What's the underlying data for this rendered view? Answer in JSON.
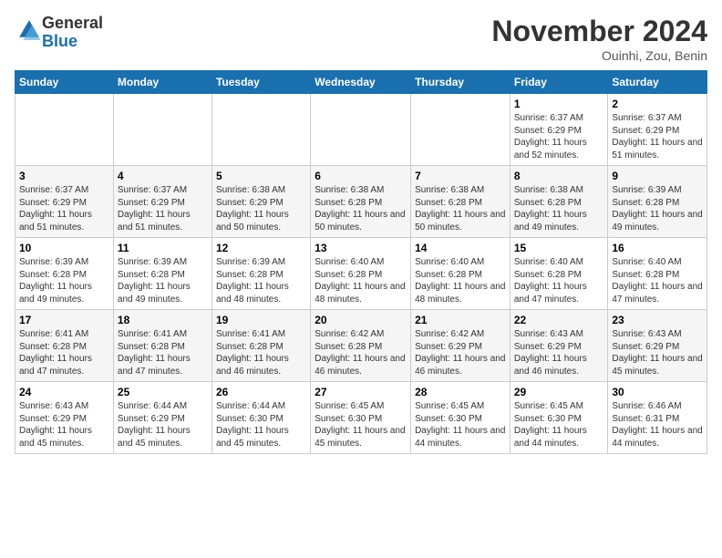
{
  "logo": {
    "general": "General",
    "blue": "Blue"
  },
  "title": "November 2024",
  "location": "Ouinhi, Zou, Benin",
  "days_of_week": [
    "Sunday",
    "Monday",
    "Tuesday",
    "Wednesday",
    "Thursday",
    "Friday",
    "Saturday"
  ],
  "weeks": [
    [
      {
        "day": "",
        "info": ""
      },
      {
        "day": "",
        "info": ""
      },
      {
        "day": "",
        "info": ""
      },
      {
        "day": "",
        "info": ""
      },
      {
        "day": "",
        "info": ""
      },
      {
        "day": "1",
        "info": "Sunrise: 6:37 AM\nSunset: 6:29 PM\nDaylight: 11 hours and 52 minutes."
      },
      {
        "day": "2",
        "info": "Sunrise: 6:37 AM\nSunset: 6:29 PM\nDaylight: 11 hours and 51 minutes."
      }
    ],
    [
      {
        "day": "3",
        "info": "Sunrise: 6:37 AM\nSunset: 6:29 PM\nDaylight: 11 hours and 51 minutes."
      },
      {
        "day": "4",
        "info": "Sunrise: 6:37 AM\nSunset: 6:29 PM\nDaylight: 11 hours and 51 minutes."
      },
      {
        "day": "5",
        "info": "Sunrise: 6:38 AM\nSunset: 6:29 PM\nDaylight: 11 hours and 50 minutes."
      },
      {
        "day": "6",
        "info": "Sunrise: 6:38 AM\nSunset: 6:28 PM\nDaylight: 11 hours and 50 minutes."
      },
      {
        "day": "7",
        "info": "Sunrise: 6:38 AM\nSunset: 6:28 PM\nDaylight: 11 hours and 50 minutes."
      },
      {
        "day": "8",
        "info": "Sunrise: 6:38 AM\nSunset: 6:28 PM\nDaylight: 11 hours and 49 minutes."
      },
      {
        "day": "9",
        "info": "Sunrise: 6:39 AM\nSunset: 6:28 PM\nDaylight: 11 hours and 49 minutes."
      }
    ],
    [
      {
        "day": "10",
        "info": "Sunrise: 6:39 AM\nSunset: 6:28 PM\nDaylight: 11 hours and 49 minutes."
      },
      {
        "day": "11",
        "info": "Sunrise: 6:39 AM\nSunset: 6:28 PM\nDaylight: 11 hours and 49 minutes."
      },
      {
        "day": "12",
        "info": "Sunrise: 6:39 AM\nSunset: 6:28 PM\nDaylight: 11 hours and 48 minutes."
      },
      {
        "day": "13",
        "info": "Sunrise: 6:40 AM\nSunset: 6:28 PM\nDaylight: 11 hours and 48 minutes."
      },
      {
        "day": "14",
        "info": "Sunrise: 6:40 AM\nSunset: 6:28 PM\nDaylight: 11 hours and 48 minutes."
      },
      {
        "day": "15",
        "info": "Sunrise: 6:40 AM\nSunset: 6:28 PM\nDaylight: 11 hours and 47 minutes."
      },
      {
        "day": "16",
        "info": "Sunrise: 6:40 AM\nSunset: 6:28 PM\nDaylight: 11 hours and 47 minutes."
      }
    ],
    [
      {
        "day": "17",
        "info": "Sunrise: 6:41 AM\nSunset: 6:28 PM\nDaylight: 11 hours and 47 minutes."
      },
      {
        "day": "18",
        "info": "Sunrise: 6:41 AM\nSunset: 6:28 PM\nDaylight: 11 hours and 47 minutes."
      },
      {
        "day": "19",
        "info": "Sunrise: 6:41 AM\nSunset: 6:28 PM\nDaylight: 11 hours and 46 minutes."
      },
      {
        "day": "20",
        "info": "Sunrise: 6:42 AM\nSunset: 6:28 PM\nDaylight: 11 hours and 46 minutes."
      },
      {
        "day": "21",
        "info": "Sunrise: 6:42 AM\nSunset: 6:29 PM\nDaylight: 11 hours and 46 minutes."
      },
      {
        "day": "22",
        "info": "Sunrise: 6:43 AM\nSunset: 6:29 PM\nDaylight: 11 hours and 46 minutes."
      },
      {
        "day": "23",
        "info": "Sunrise: 6:43 AM\nSunset: 6:29 PM\nDaylight: 11 hours and 45 minutes."
      }
    ],
    [
      {
        "day": "24",
        "info": "Sunrise: 6:43 AM\nSunset: 6:29 PM\nDaylight: 11 hours and 45 minutes."
      },
      {
        "day": "25",
        "info": "Sunrise: 6:44 AM\nSunset: 6:29 PM\nDaylight: 11 hours and 45 minutes."
      },
      {
        "day": "26",
        "info": "Sunrise: 6:44 AM\nSunset: 6:30 PM\nDaylight: 11 hours and 45 minutes."
      },
      {
        "day": "27",
        "info": "Sunrise: 6:45 AM\nSunset: 6:30 PM\nDaylight: 11 hours and 45 minutes."
      },
      {
        "day": "28",
        "info": "Sunrise: 6:45 AM\nSunset: 6:30 PM\nDaylight: 11 hours and 44 minutes."
      },
      {
        "day": "29",
        "info": "Sunrise: 6:45 AM\nSunset: 6:30 PM\nDaylight: 11 hours and 44 minutes."
      },
      {
        "day": "30",
        "info": "Sunrise: 6:46 AM\nSunset: 6:31 PM\nDaylight: 11 hours and 44 minutes."
      }
    ]
  ]
}
